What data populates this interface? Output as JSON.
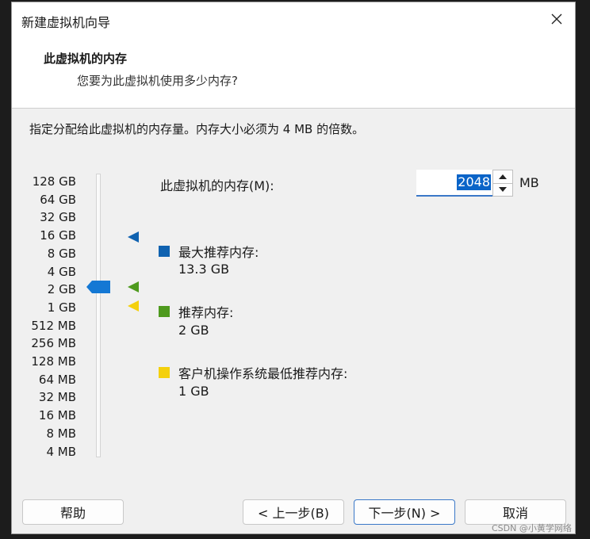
{
  "window": {
    "title": "新建虚拟机向导"
  },
  "header": {
    "title": "此虚拟机的内存",
    "subtitle": "您要为此虚拟机使用多少内存?"
  },
  "instruction": "指定分配给此虚拟机的内存量。内存大小必须为 4 MB 的倍数。",
  "memory_scale": [
    "128 GB",
    "64 GB",
    "32 GB",
    "16 GB",
    "8 GB",
    "4 GB",
    "2 GB",
    "1 GB",
    "512 MB",
    "256 MB",
    "128 MB",
    "64 MB",
    "32 MB",
    "16 MB",
    "8 MB",
    "4 MB"
  ],
  "slider": {
    "current": "2 GB"
  },
  "memory_field": {
    "label": "此虚拟机的内存(M):",
    "value": "2048",
    "unit": "MB"
  },
  "legend": [
    {
      "title": "最大推荐内存:",
      "value": "13.3 GB",
      "color": "#0f62b0"
    },
    {
      "title": "推荐内存:",
      "value": "2 GB",
      "color": "#4e9a1e"
    },
    {
      "title": "客户机操作系统最低推荐内存:",
      "value": "1 GB",
      "color": "#f4d00c"
    }
  ],
  "colors": {
    "slider_thumb": "#1478d4",
    "accent": "#3a78c8"
  },
  "buttons": {
    "help": "帮助",
    "back": "< 上一步(B)",
    "next": "下一步(N) >",
    "cancel": "取消"
  },
  "watermark": "CSDN @小黄学网络"
}
